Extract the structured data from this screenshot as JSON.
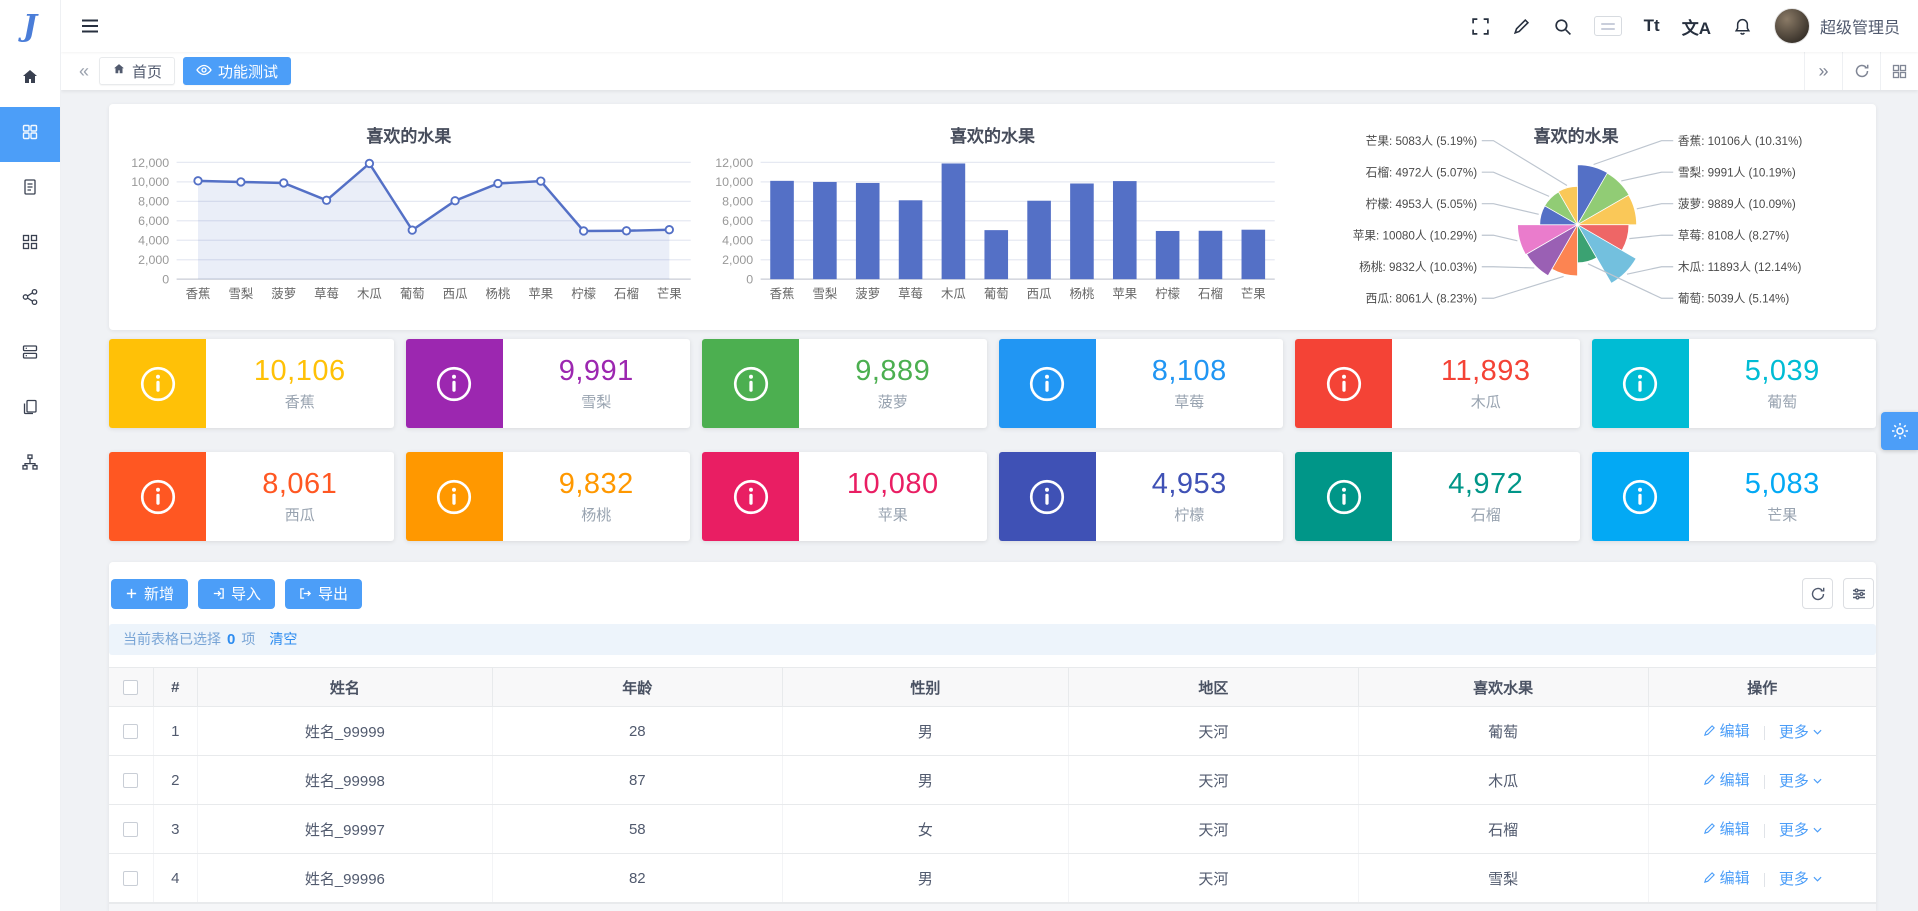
{
  "colors": {
    "accent": "#4c9ef8",
    "chart_main": "#5470c6",
    "pie_palette": [
      "#5470c6",
      "#91cc75",
      "#fac858",
      "#ee6666",
      "#73c0de",
      "#3ba272",
      "#fc8452",
      "#9a60b4",
      "#ea7ccc",
      "#5470c6",
      "#91cc75",
      "#fac858"
    ]
  },
  "app": {
    "logo_letter": "J",
    "user_name": "超级管理员"
  },
  "header_icons": {
    "font_size_label": "Tt",
    "translate_label": "文A"
  },
  "tabs": {
    "home_label": "首页",
    "active_label": "功能测试"
  },
  "chart_data": [
    {
      "type": "line",
      "title": "喜欢的水果",
      "categories": [
        "香蕉",
        "雪梨",
        "菠萝",
        "草莓",
        "木瓜",
        "葡萄",
        "西瓜",
        "杨桃",
        "苹果",
        "柠檬",
        "石榴",
        "芒果"
      ],
      "values": [
        10106,
        9991,
        9889,
        8108,
        11893,
        5039,
        8061,
        9832,
        10080,
        4953,
        4972,
        5083
      ],
      "ylim": [
        0,
        12000
      ],
      "ytick_step": 2000,
      "grid": true,
      "legend": false
    },
    {
      "type": "bar",
      "title": "喜欢的水果",
      "categories": [
        "香蕉",
        "雪梨",
        "菠萝",
        "草莓",
        "木瓜",
        "葡萄",
        "西瓜",
        "杨桃",
        "苹果",
        "柠檬",
        "石榴",
        "芒果"
      ],
      "values": [
        10106,
        9991,
        9889,
        8108,
        11893,
        5039,
        8061,
        9832,
        10080,
        4953,
        4972,
        5083
      ],
      "ylim": [
        0,
        12000
      ],
      "ytick_step": 2000,
      "grid": true,
      "legend": false
    },
    {
      "type": "pie",
      "rose": true,
      "title": "喜欢的水果",
      "items": [
        {
          "name": "香蕉",
          "value": 10106,
          "pct": "10.31%"
        },
        {
          "name": "雪梨",
          "value": 9991,
          "pct": "10.19%"
        },
        {
          "name": "菠萝",
          "value": 9889,
          "pct": "10.09%"
        },
        {
          "name": "草莓",
          "value": 8108,
          "pct": "8.27%"
        },
        {
          "name": "木瓜",
          "value": 11893,
          "pct": "12.14%"
        },
        {
          "name": "葡萄",
          "value": 5039,
          "pct": "5.14%"
        },
        {
          "name": "西瓜",
          "value": 8061,
          "pct": "8.23%"
        },
        {
          "name": "杨桃",
          "value": 9832,
          "pct": "10.03%"
        },
        {
          "name": "苹果",
          "value": 10080,
          "pct": "10.29%"
        },
        {
          "name": "柠檬",
          "value": 4953,
          "pct": "5.05%"
        },
        {
          "name": "石榴",
          "value": 4972,
          "pct": "5.07%"
        },
        {
          "name": "芒果",
          "value": 5083,
          "pct": "5.19%"
        }
      ]
    }
  ],
  "cards": [
    {
      "value": "10,106",
      "label": "香蕉",
      "color": "#ffc107"
    },
    {
      "value": "9,991",
      "label": "雪梨",
      "color": "#9c27b0"
    },
    {
      "value": "9,889",
      "label": "菠萝",
      "color": "#4caf50"
    },
    {
      "value": "8,108",
      "label": "草莓",
      "color": "#2196f3"
    },
    {
      "value": "11,893",
      "label": "木瓜",
      "color": "#f44336"
    },
    {
      "value": "5,039",
      "label": "葡萄",
      "color": "#00bcd4"
    },
    {
      "value": "8,061",
      "label": "西瓜",
      "color": "#ff5722"
    },
    {
      "value": "9,832",
      "label": "杨桃",
      "color": "#ff9800"
    },
    {
      "value": "10,080",
      "label": "苹果",
      "color": "#e91e63"
    },
    {
      "value": "4,953",
      "label": "柠檬",
      "color": "#3f51b5"
    },
    {
      "value": "4,972",
      "label": "石榴",
      "color": "#009688"
    },
    {
      "value": "5,083",
      "label": "芒果",
      "color": "#03a9f4"
    }
  ],
  "toolbar": {
    "add_label": "新增",
    "import_label": "导入",
    "export_label": "导出"
  },
  "selection_bar": {
    "prefix": "当前表格已选择",
    "count": "0",
    "suffix": "项",
    "clear_label": "清空"
  },
  "table": {
    "headers": [
      "#",
      "姓名",
      "年龄",
      "性别",
      "地区",
      "喜欢水果",
      "操作"
    ],
    "edit_label": "编辑",
    "more_label": "更多",
    "rows": [
      {
        "index": "1",
        "name": "姓名_99999",
        "age": "28",
        "gender": "男",
        "region": "天河",
        "fruit": "葡萄"
      },
      {
        "index": "2",
        "name": "姓名_99998",
        "age": "87",
        "gender": "男",
        "region": "天河",
        "fruit": "木瓜"
      },
      {
        "index": "3",
        "name": "姓名_99997",
        "age": "58",
        "gender": "女",
        "region": "天河",
        "fruit": "石榴"
      },
      {
        "index": "4",
        "name": "姓名_99996",
        "age": "82",
        "gender": "男",
        "region": "天河",
        "fruit": "雪梨"
      }
    ]
  }
}
